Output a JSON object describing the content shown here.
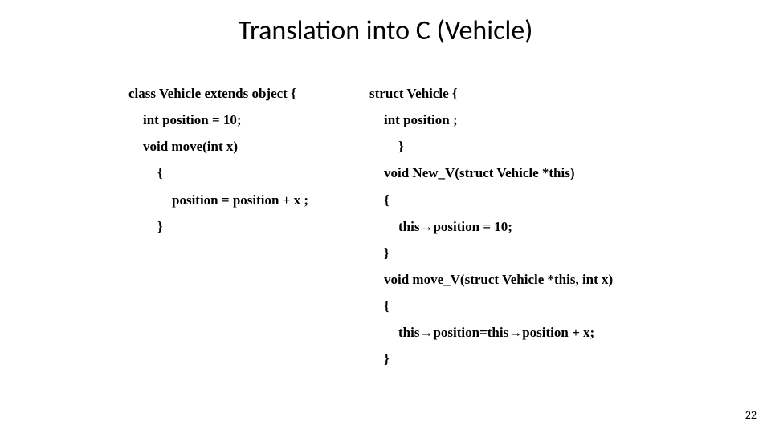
{
  "title": "Translation into C (Vehicle)",
  "left": {
    "l1": "class Vehicle extends object {",
    "l2": "int position = 10;",
    "l3": "void move(int x)",
    "l4": "{",
    "l5": "position = position + x ;",
    "l6": "}"
  },
  "right": {
    "r1": "struct  Vehicle {",
    "r2": "int position ;",
    "r3": "}",
    "r4": "void New_V(struct Vehicle *this)",
    "r5": "{",
    "r6": "this→position = 10;",
    "r7": "}",
    "r8": "void move_V(struct Vehicle *this, int x)",
    "r9": "{",
    "r10": "this→position=this→position + x;",
    "r11": "}"
  },
  "page": "22"
}
